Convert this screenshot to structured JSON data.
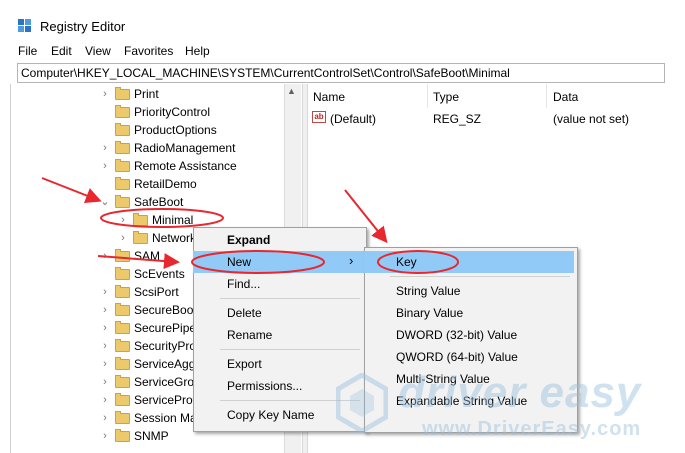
{
  "window": {
    "title": "Registry Editor",
    "icon": "registry-editor-icon"
  },
  "menu": [
    "File",
    "Edit",
    "View",
    "Favorites",
    "Help"
  ],
  "address": "Computer\\HKEY_LOCAL_MACHINE\\SYSTEM\\CurrentControlSet\\Control\\SafeBoot\\Minimal",
  "tree": [
    {
      "label": "Print",
      "expander": "collapsed"
    },
    {
      "label": "PriorityControl",
      "expander": "none"
    },
    {
      "label": "ProductOptions",
      "expander": "none"
    },
    {
      "label": "RadioManagement",
      "expander": "collapsed"
    },
    {
      "label": "Remote Assistance",
      "expander": "collapsed"
    },
    {
      "label": "RetailDemo",
      "expander": "none"
    },
    {
      "label": "SafeBoot",
      "expander": "expanded"
    },
    {
      "label": "Minimal",
      "expander": "collapsed",
      "child": true,
      "selected": true
    },
    {
      "label": "Network",
      "expander": "collapsed",
      "child": true
    },
    {
      "label": "SAM",
      "expander": "collapsed"
    },
    {
      "label": "ScEvents",
      "expander": "none"
    },
    {
      "label": "ScsiPort",
      "expander": "collapsed"
    },
    {
      "label": "SecureBoot",
      "expander": "collapsed"
    },
    {
      "label": "SecurePipe",
      "expander": "collapsed"
    },
    {
      "label": "SecurityPro",
      "expander": "collapsed"
    },
    {
      "label": "ServiceAgg",
      "expander": "collapsed"
    },
    {
      "label": "ServiceGrou",
      "expander": "collapsed"
    },
    {
      "label": "ServiceProv",
      "expander": "collapsed"
    },
    {
      "label": "Session Ma",
      "expander": "collapsed"
    },
    {
      "label": "SNMP",
      "expander": "collapsed"
    }
  ],
  "list": {
    "columns": [
      "Name",
      "Type",
      "Data"
    ],
    "rows": [
      {
        "name": "(Default)",
        "type": "REG_SZ",
        "data": "(value not set)",
        "icon": "ab"
      }
    ]
  },
  "context_menu": {
    "items": [
      "Expand",
      "New",
      "Find...",
      "Delete",
      "Rename",
      "Export",
      "Permissions...",
      "Copy Key Name"
    ],
    "highlighted": "New",
    "submenu_arrow": "›"
  },
  "submenu": {
    "items": [
      "Key",
      "String Value",
      "Binary Value",
      "DWORD (32-bit) Value",
      "QWORD (64-bit) Value",
      "Multi-String Value",
      "Expandable String Value"
    ],
    "highlighted": "Key"
  },
  "watermark": {
    "brand": "driver easy",
    "url": "www.DriverEasy.com"
  },
  "colors": {
    "highlight": "#91c9f7",
    "annotation_red": "#e8272e",
    "folder": "#ecc96a"
  }
}
